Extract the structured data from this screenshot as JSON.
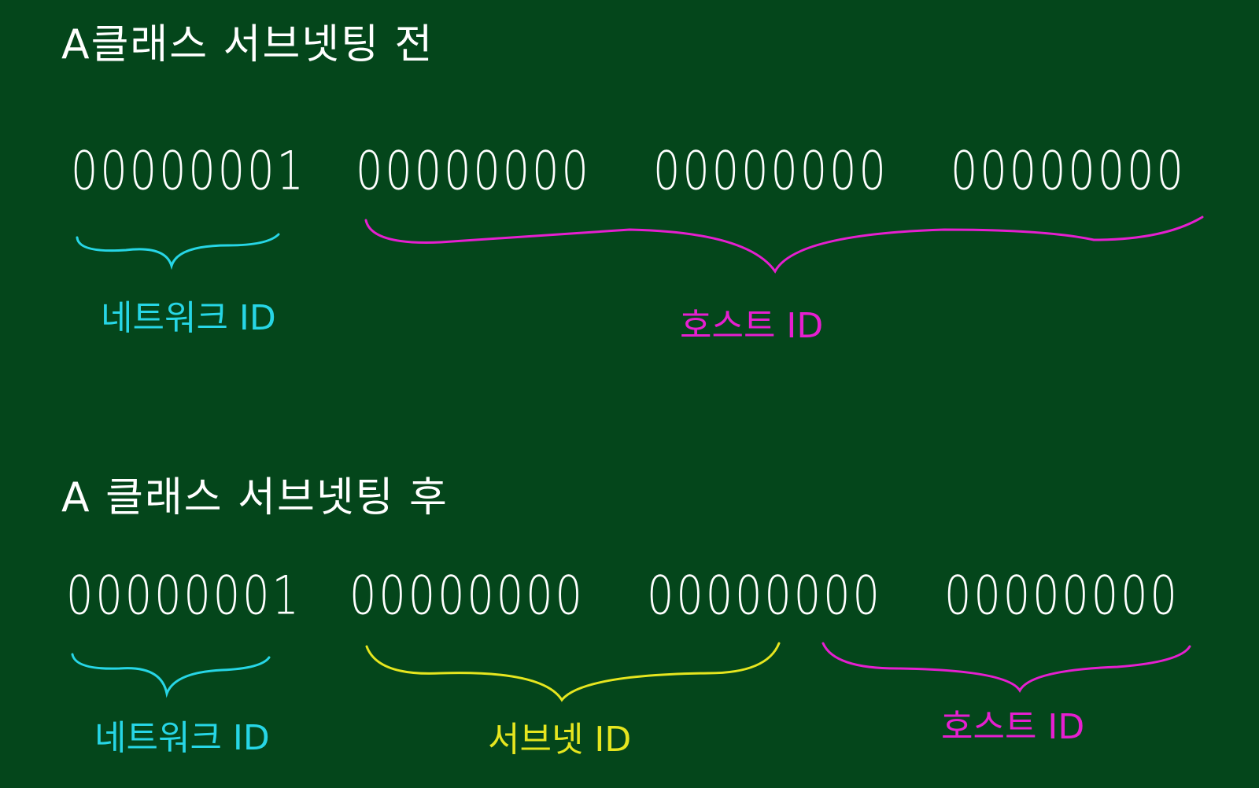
{
  "colors": {
    "background": "#04461b",
    "chalk_white": "#ffffff",
    "network": "#27d6e6",
    "host": "#e61fd0",
    "subnet": "#e6e61f"
  },
  "before": {
    "title": "A클래스 서브넷팅 전",
    "octets": [
      "00000001",
      "00000000",
      "00000000",
      "00000000"
    ],
    "network_label": "네트워크 ID",
    "host_label": "호스트 ID"
  },
  "after": {
    "title": "A 클래스 서브넷팅 후",
    "octets": [
      "00000001",
      "00000000",
      "00000000",
      "00000000"
    ],
    "network_label": "네트워크 ID",
    "subnet_label": "서브넷 ID",
    "host_label": "호스트 ID"
  }
}
